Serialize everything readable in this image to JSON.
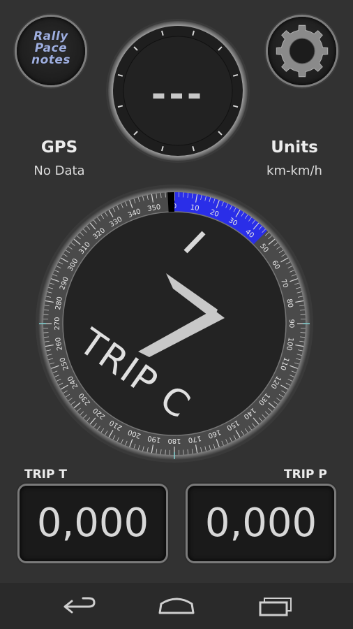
{
  "logo": {
    "line1": "Rally",
    "line2": "Pace",
    "line3": "notes",
    "icon": "rally-pace-notes-logo"
  },
  "settings": {
    "icon": "gear-icon"
  },
  "heading": {
    "value": "---"
  },
  "gps": {
    "label": "GPS",
    "value": "No Data"
  },
  "units": {
    "label": "Units",
    "value": "km-km/h"
  },
  "main_dial": {
    "trip_label": "TRIP C",
    "turn_symbol": "7",
    "degree_ticks": [
      "0",
      "10",
      "20",
      "30",
      "40",
      "50",
      "60",
      "70",
      "80",
      "90",
      "100",
      "110",
      "120",
      "130",
      "140",
      "150",
      "160",
      "170",
      "180",
      "190",
      "200",
      "210",
      "220",
      "230",
      "240",
      "250",
      "260",
      "270",
      "280",
      "290",
      "300",
      "310",
      "320",
      "330",
      "340",
      "350"
    ],
    "highlight_range": [
      0,
      45
    ],
    "highlight_color": "#2a2ee8"
  },
  "trip_t": {
    "label": "TRIP T",
    "value": "0,000"
  },
  "trip_p": {
    "label": "TRIP P",
    "value": "0,000"
  },
  "navbar": {
    "back_icon": "back-icon",
    "home_icon": "home-icon",
    "recents_icon": "recent-apps-icon"
  }
}
